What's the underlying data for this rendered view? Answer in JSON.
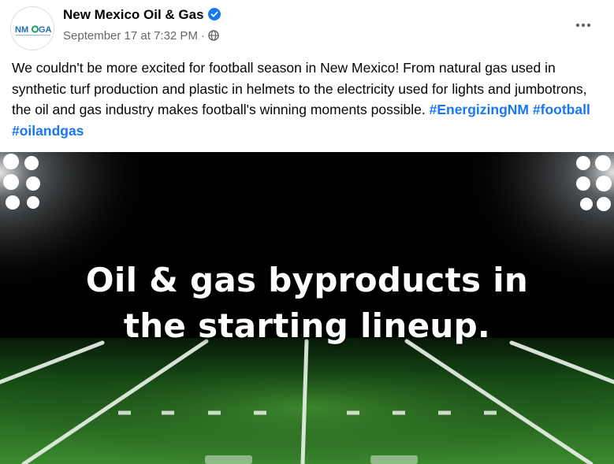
{
  "post": {
    "page_name": "New Mexico Oil & Gas",
    "verified": true,
    "timestamp": "September 17 at 7:32 PM",
    "separator": "·",
    "audience_icon": "globe-icon",
    "more_icon": "more-horizontal-icon",
    "avatar": {
      "logo_text": "NMOGA",
      "colors": {
        "text": "#1d6fb8",
        "accent": "#1ea06a"
      }
    },
    "text": "We couldn't be more excited for football season in New Mexico! From natural gas used in synthetic turf production and plastic in helmets to the electricity used for lights and jumbotrons, the oil and gas industry makes football's winning moments possible.",
    "hashtags": [
      "#EnergizingNM",
      "#football",
      "#oilandgas"
    ]
  },
  "media": {
    "headline_line1": "Oil & gas byproducts in",
    "headline_line2": "the starting lineup.",
    "colors": {
      "sky": "#000000",
      "field_dark": "#0b2e10",
      "field": "#2f7a27",
      "lines": "#e8f0e6"
    }
  },
  "colors": {
    "link": "#1877f2",
    "secondary_text": "#65676b",
    "verified_badge": "#1877f2"
  }
}
